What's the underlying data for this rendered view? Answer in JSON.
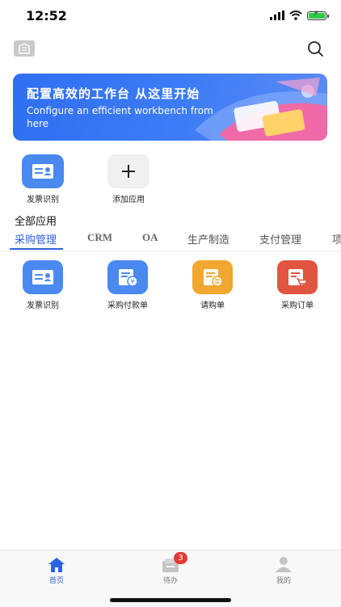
{
  "status": {
    "time": "12:52"
  },
  "banner": {
    "title": "配置高效的工作台 从这里开始",
    "subtitle": "Configure an efficient workbench from here"
  },
  "quick_apps": [
    {
      "label": "发票识别",
      "icon": "invoice-card-icon",
      "color": "#4a8af0"
    },
    {
      "label": "添加应用",
      "icon": "plus-icon",
      "color": "#f0f0f0"
    }
  ],
  "section": {
    "title": "全部应用"
  },
  "tabs": [
    {
      "label": "采购管理",
      "active": true
    },
    {
      "label": "CRM",
      "active": false
    },
    {
      "label": "OA",
      "active": false
    },
    {
      "label": "生产制造",
      "active": false
    },
    {
      "label": "支付管理",
      "active": false
    },
    {
      "label": "项",
      "active": false
    }
  ],
  "apps": [
    {
      "label": "发票识别",
      "icon": "invoice-card-icon",
      "color": "#4a8af0"
    },
    {
      "label": "采购付款单",
      "icon": "payment-doc-icon",
      "color": "#4a8af0"
    },
    {
      "label": "请购单",
      "icon": "requisition-doc-icon",
      "color": "#f0a830"
    },
    {
      "label": "采购订单",
      "icon": "cart-doc-icon",
      "color": "#e05540"
    }
  ],
  "tabbar": [
    {
      "label": "首页",
      "icon": "home-icon",
      "active": true
    },
    {
      "label": "待办",
      "icon": "inbox-icon",
      "active": false,
      "badge": "3"
    },
    {
      "label": "我的",
      "icon": "user-icon",
      "active": false
    }
  ],
  "colors": {
    "accent": "#2c63e0",
    "badge": "#e53935"
  }
}
